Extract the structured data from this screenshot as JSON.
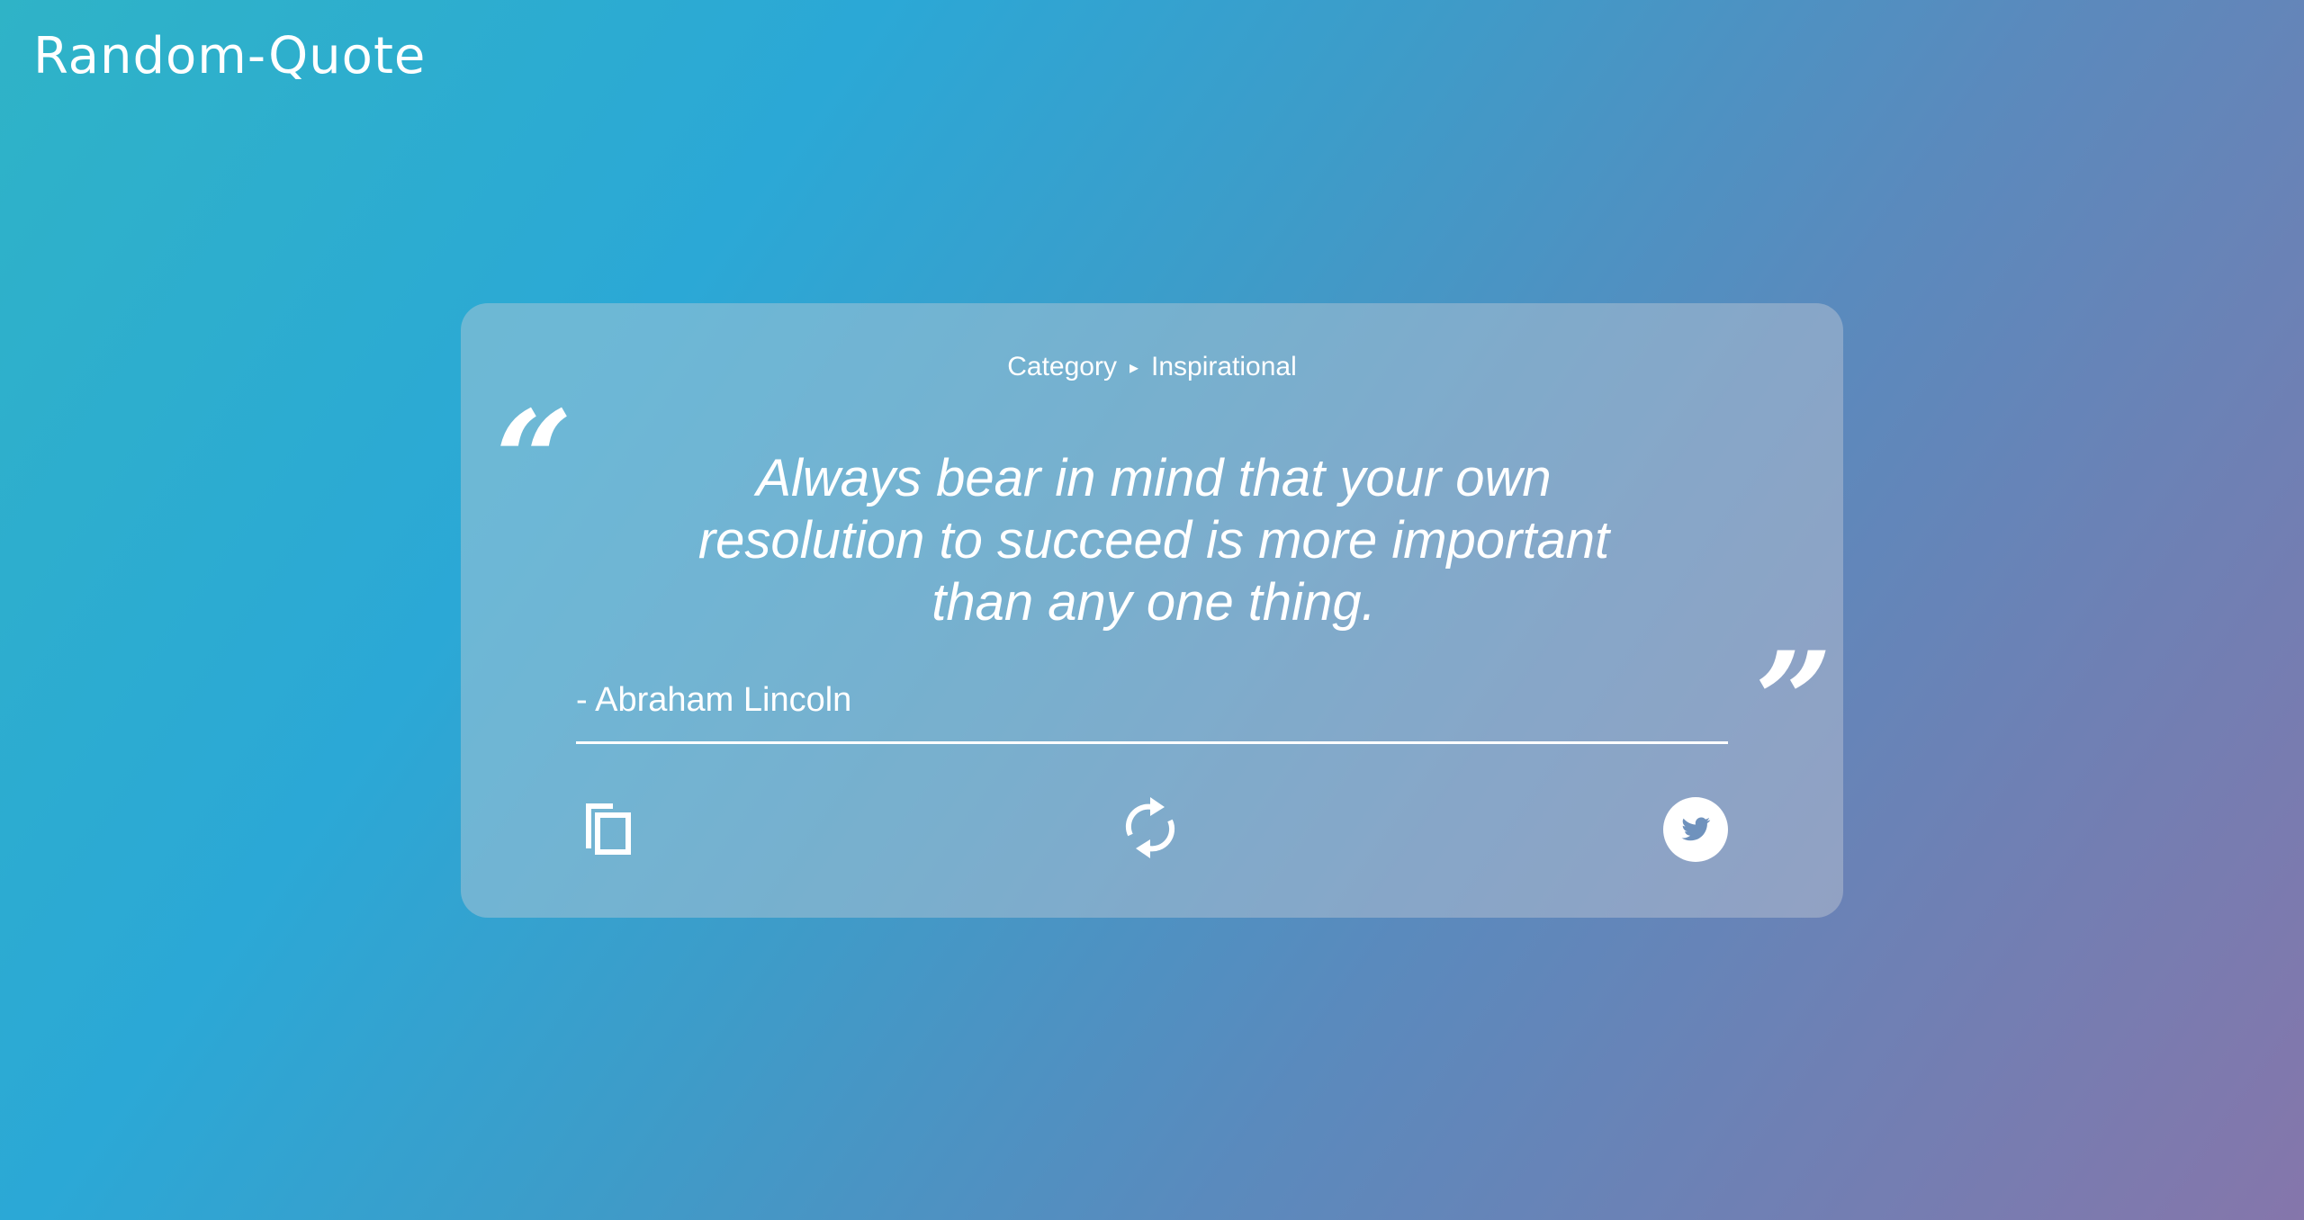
{
  "header": {
    "title": "Random-Quote"
  },
  "quote_card": {
    "category_label": "Category",
    "category_arrow": "▸",
    "category_value": "Inspirational",
    "open_quote_mark": "“",
    "close_quote_mark": "”",
    "text": "Always bear in mind that your own resolution to succeed is more important than any one thing.",
    "author": "- Abraham Lincoln"
  },
  "actions": {
    "copy_icon": "copy-icon",
    "new_quote_icon": "refresh-icon",
    "tweet_icon": "twitter-icon"
  },
  "colors": {
    "background_start": "#2fb3c7",
    "background_end": "#8576ab",
    "text": "#ffffff"
  }
}
